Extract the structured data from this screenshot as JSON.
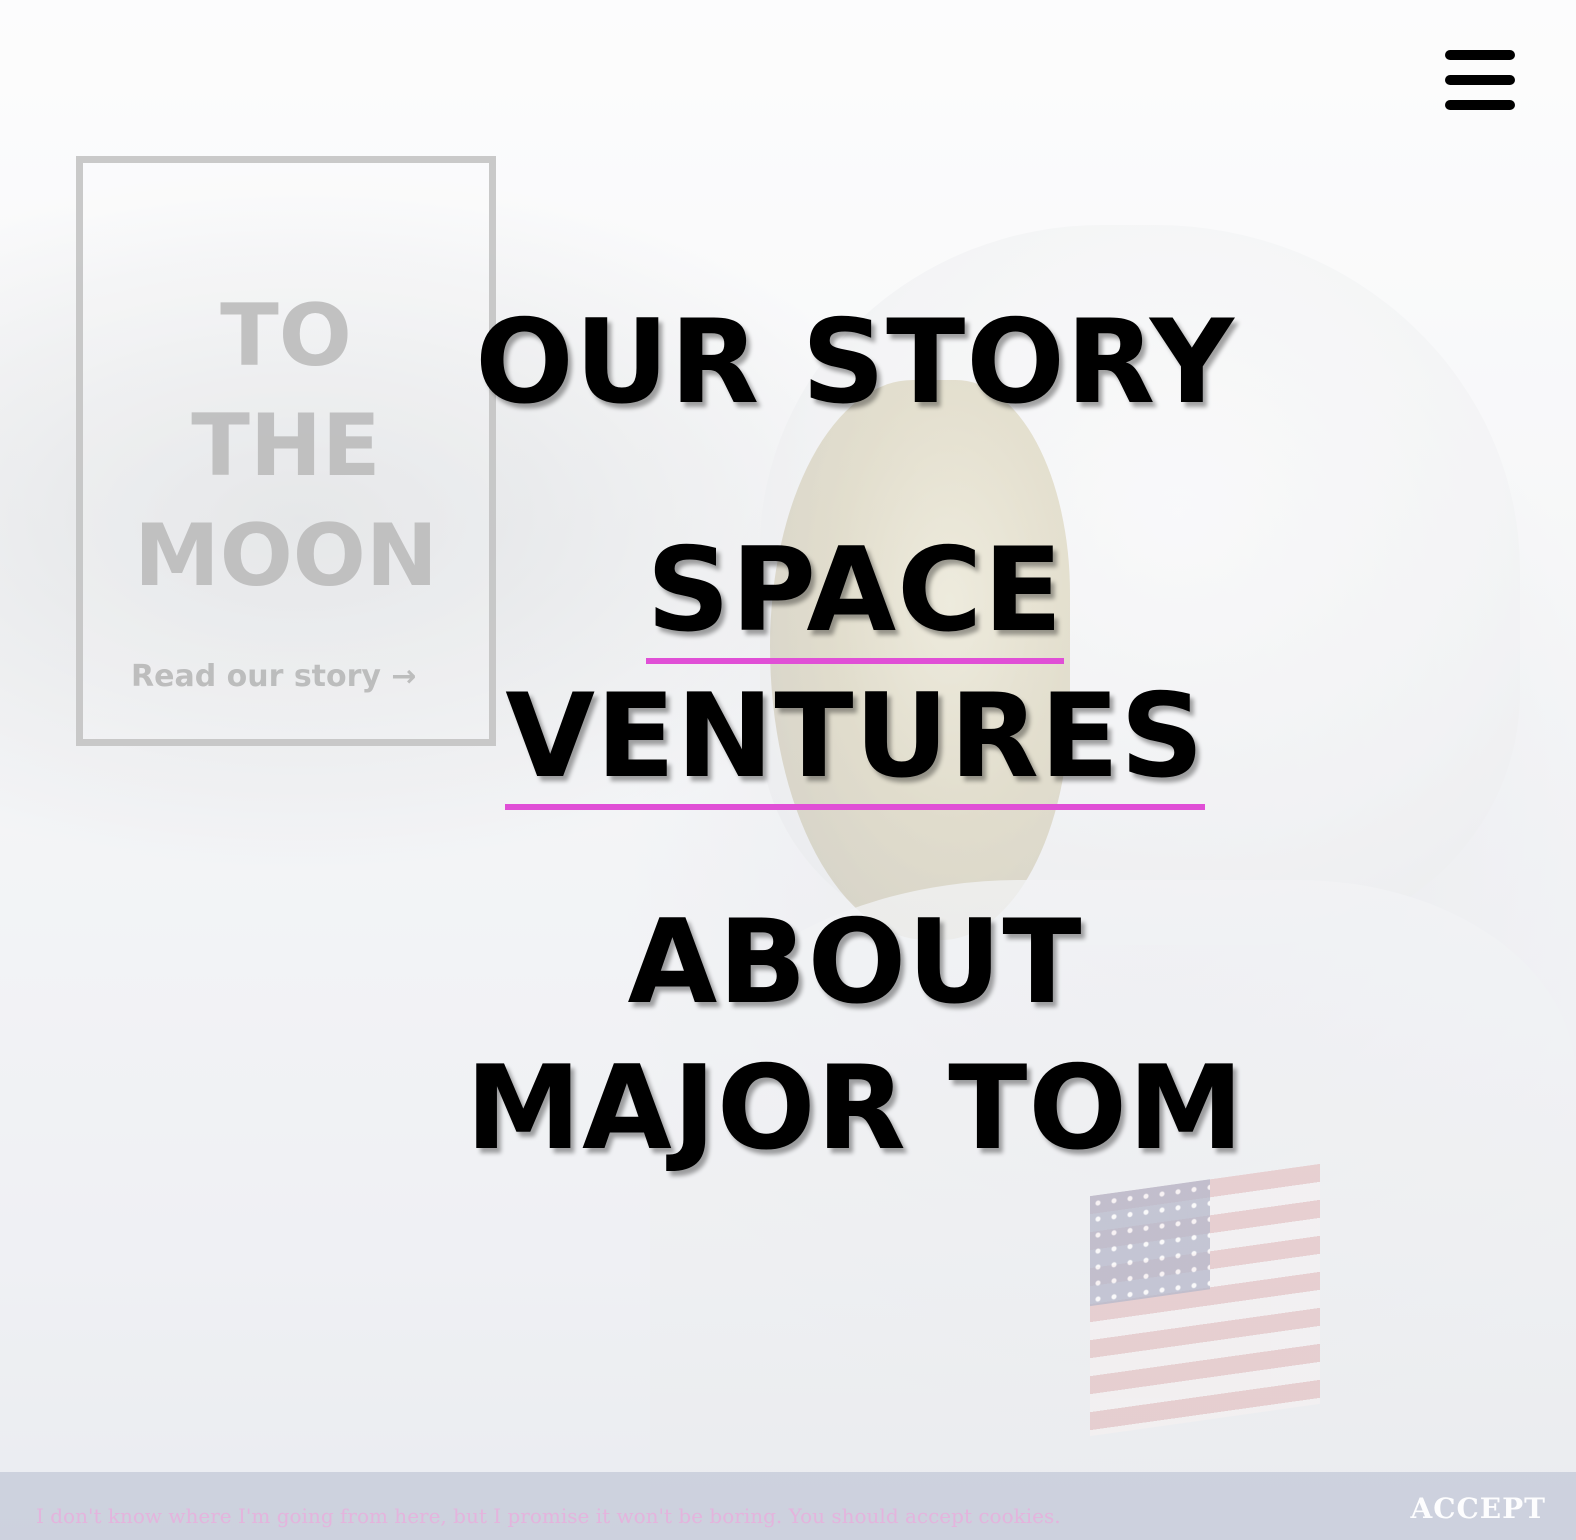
{
  "logo": {
    "lines": [
      "TO",
      "THE",
      "MOON"
    ],
    "link_label": "Read our story →"
  },
  "nav": {
    "menu_button_icon": "hamburger-menu-icon",
    "items": [
      {
        "lines": [
          "OUR STORY"
        ],
        "active": false
      },
      {
        "lines": [
          "SPACE",
          "VENTURES"
        ],
        "active": true
      },
      {
        "lines": [
          "ABOUT",
          "MAJOR TOM"
        ],
        "active": false
      }
    ],
    "active_underline_color": "#e04fd6"
  },
  "cookie_banner": {
    "message": "I don't know where I'm going from here, but I promise it won't be boring. You should accept cookies.",
    "accept_label": "ACCEPT"
  }
}
